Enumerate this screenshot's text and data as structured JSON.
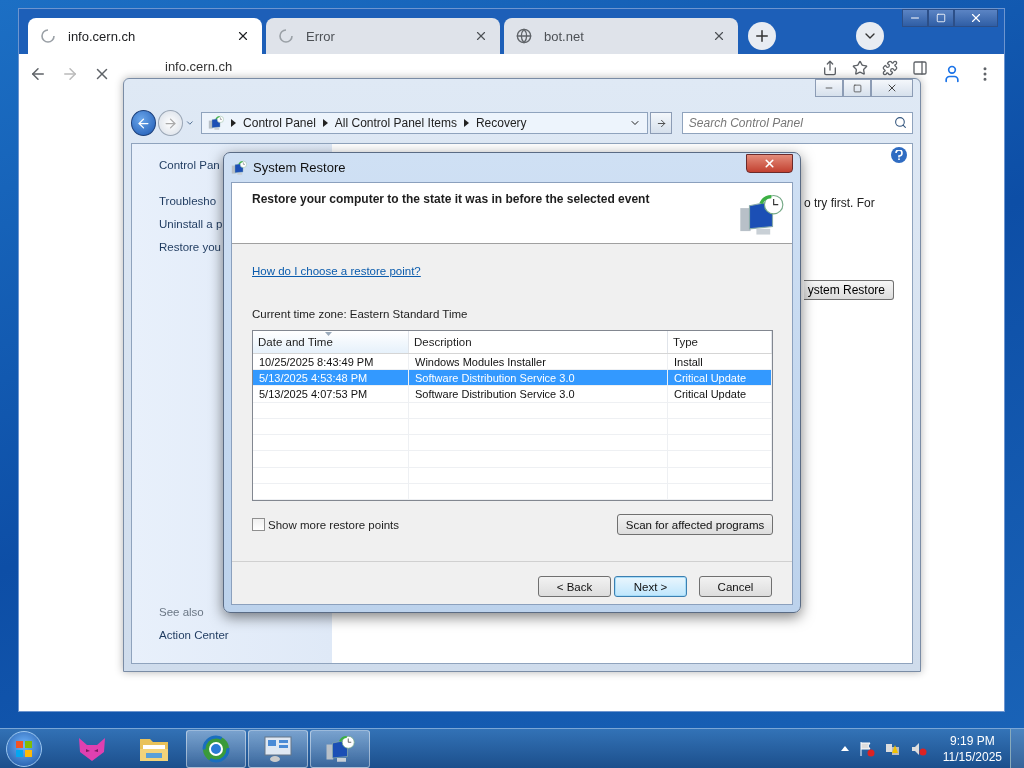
{
  "browser": {
    "tabs": [
      {
        "title": "info.cern.ch",
        "selected": true,
        "kind": "loading"
      },
      {
        "title": "Error",
        "selected": false,
        "kind": "loading"
      },
      {
        "title": "bot.net",
        "selected": false,
        "kind": "site"
      }
    ],
    "address": "info.cern.ch"
  },
  "control_panel": {
    "breadcrumb": [
      "Control Panel",
      "All Control Panel Items",
      "Recovery"
    ],
    "search": {
      "placeholder": "Search Control Panel"
    },
    "sidebar": {
      "home": "Control Pan",
      "links": [
        "Troublesho",
        "Uninstall a p",
        "Restore you"
      ],
      "see_also_heading": "See also",
      "see_also": [
        "Action Center"
      ]
    },
    "content_text": "o try first. For",
    "button": "ystem Restore"
  },
  "dialog": {
    "title": "System Restore",
    "heading": "Restore your computer to the state it was in before the selected event",
    "help_link": "How do I choose a restore point?",
    "timezone": "Current time zone: Eastern Standard Time",
    "table": {
      "columns": [
        "Date and Time",
        "Description",
        "Type"
      ],
      "rows": [
        {
          "cells": [
            "10/25/2025 8:43:49 PM",
            "Windows Modules Installer",
            "Install"
          ],
          "selected": false
        },
        {
          "cells": [
            "5/13/2025 4:53:48 PM",
            "Software Distribution Service 3.0",
            "Critical Update"
          ],
          "selected": true
        },
        {
          "cells": [
            "5/13/2025 4:07:53 PM",
            "Software Distribution Service 3.0",
            "Critical Update"
          ],
          "selected": false
        }
      ]
    },
    "show_more": {
      "label": "Show more restore points",
      "checked": false
    },
    "scan_button": "Scan for affected programs",
    "buttons": [
      {
        "label": "< Back",
        "focused": false
      },
      {
        "label": "Next >",
        "focused": true
      },
      {
        "label": "Cancel",
        "focused": false
      }
    ]
  },
  "taskbar": {
    "apps": [
      {
        "kind": "cat",
        "running": false
      },
      {
        "kind": "folder",
        "running": false
      },
      {
        "kind": "browser",
        "running": true
      },
      {
        "kind": "control-panel",
        "running": true
      },
      {
        "kind": "restore",
        "running": true
      }
    ],
    "clock": {
      "time": "9:19 PM",
      "date": "11/15/2025"
    }
  }
}
